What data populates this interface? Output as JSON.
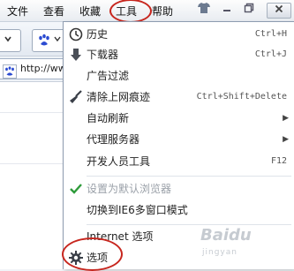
{
  "menubar": {
    "items": [
      "文件",
      "查看",
      "收藏",
      "工具",
      "帮助"
    ],
    "active_index": 3
  },
  "address": {
    "url": "http://www"
  },
  "tools_menu": {
    "items": [
      {
        "label": "历史",
        "shortcut": "Ctrl+H",
        "icon": "history-clock-icon"
      },
      {
        "label": "下载器",
        "shortcut": "Ctrl+J",
        "icon": "download-arrow-icon"
      },
      {
        "label": "广告过滤",
        "shortcut": ""
      },
      {
        "label": "清除上网痕迹",
        "shortcut": "Ctrl+Shift+Delete",
        "icon": "broom-icon"
      },
      {
        "label": "自动刷新",
        "submenu": true
      },
      {
        "label": "代理服务器",
        "submenu": true
      },
      {
        "label": "开发人员工具",
        "shortcut": "F12"
      },
      {
        "label": "设置为默认浏览器",
        "disabled": true,
        "icon": "checkmark-icon"
      },
      {
        "label": "切换到IE6多窗口模式"
      },
      {
        "label": "Internet 选项"
      },
      {
        "label": "选项",
        "icon": "gear-icon"
      }
    ]
  },
  "watermark": {
    "logo_text": "Baidu",
    "sub": "jingyan"
  },
  "colors": {
    "highlight_ellipse": "#c7261e",
    "check_green": "#2e9b3a"
  }
}
